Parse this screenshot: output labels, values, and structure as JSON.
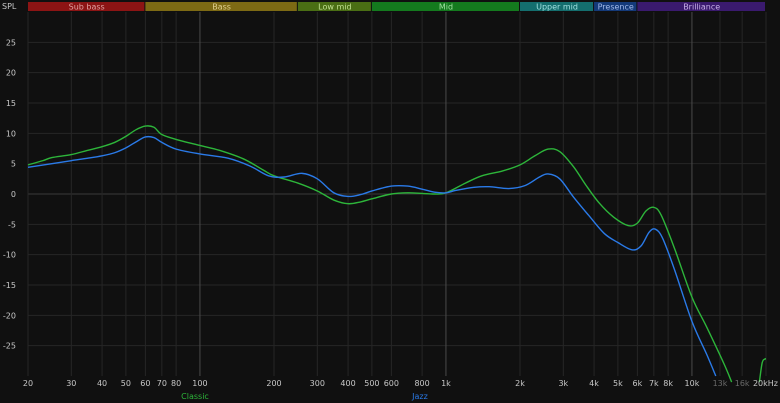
{
  "chart_data": {
    "type": "line",
    "ylabel": "SPL",
    "ylim": [
      -30,
      30
    ],
    "xlim": [
      20,
      20000
    ],
    "x_scale": "log",
    "grid": true,
    "x_ticks": [
      {
        "value": 20,
        "label": "20"
      },
      {
        "value": 30,
        "label": "30"
      },
      {
        "value": 40,
        "label": "40"
      },
      {
        "value": 50,
        "label": "50"
      },
      {
        "value": 60,
        "label": "60"
      },
      {
        "value": 70,
        "label": "70"
      },
      {
        "value": 80,
        "label": "80"
      },
      {
        "value": 100,
        "label": "100"
      },
      {
        "value": 200,
        "label": "200"
      },
      {
        "value": 300,
        "label": "300"
      },
      {
        "value": 400,
        "label": "400"
      },
      {
        "value": 500,
        "label": "500"
      },
      {
        "value": 600,
        "label": "600"
      },
      {
        "value": 800,
        "label": "800"
      },
      {
        "value": 1000,
        "label": "1k"
      },
      {
        "value": 2000,
        "label": "2k"
      },
      {
        "value": 3000,
        "label": "3k"
      },
      {
        "value": 4000,
        "label": "4k"
      },
      {
        "value": 5000,
        "label": "5k"
      },
      {
        "value": 6000,
        "label": "6k"
      },
      {
        "value": 7000,
        "label": "7k"
      },
      {
        "value": 8000,
        "label": "8k"
      },
      {
        "value": 10000,
        "label": "10k"
      },
      {
        "value": 13000,
        "label": "13k",
        "dim": true
      },
      {
        "value": 16000,
        "label": "16k",
        "dim": true
      },
      {
        "value": 20000,
        "label": "20kHz"
      }
    ],
    "y_ticks": [
      25,
      20,
      15,
      10,
      5,
      0,
      -5,
      -10,
      -15,
      -20,
      -25
    ],
    "bands": [
      {
        "label": "Sub bass",
        "from": 20,
        "to": 60,
        "color": "#8c1414",
        "text_color": "#e0a0a0"
      },
      {
        "label": "Bass",
        "from": 60,
        "to": 250,
        "color": "#7d6a14",
        "text_color": "#e0d090"
      },
      {
        "label": "Low mid",
        "from": 250,
        "to": 500,
        "color": "#4a6e14",
        "text_color": "#c0e090"
      },
      {
        "label": "Mid",
        "from": 500,
        "to": 2000,
        "color": "#147a1e",
        "text_color": "#a0e0a0"
      },
      {
        "label": "Upper mid",
        "from": 2000,
        "to": 4000,
        "color": "#146e6e",
        "text_color": "#a0e0e0"
      },
      {
        "label": "Presence",
        "from": 4000,
        "to": 6000,
        "color": "#143a7a",
        "text_color": "#a0b8e8"
      },
      {
        "label": "Brilliance",
        "from": 6000,
        "to": 20000,
        "color": "#3a1a6e",
        "text_color": "#c8b0e8"
      }
    ],
    "series": [
      {
        "name": "Classic",
        "color": "#2db53a",
        "points": [
          [
            20,
            4.8
          ],
          [
            23,
            5.5
          ],
          [
            25,
            6.0
          ],
          [
            30,
            6.5
          ],
          [
            35,
            7.2
          ],
          [
            40,
            7.8
          ],
          [
            45,
            8.5
          ],
          [
            50,
            9.5
          ],
          [
            55,
            10.6
          ],
          [
            60,
            11.2
          ],
          [
            65,
            11.0
          ],
          [
            70,
            9.8
          ],
          [
            80,
            9.0
          ],
          [
            100,
            8.0
          ],
          [
            120,
            7.2
          ],
          [
            150,
            5.8
          ],
          [
            180,
            4.0
          ],
          [
            200,
            3.0
          ],
          [
            250,
            1.8
          ],
          [
            300,
            0.5
          ],
          [
            350,
            -1.0
          ],
          [
            400,
            -1.6
          ],
          [
            450,
            -1.3
          ],
          [
            500,
            -0.8
          ],
          [
            600,
            0.0
          ],
          [
            700,
            0.2
          ],
          [
            800,
            0.1
          ],
          [
            900,
            0.0
          ],
          [
            1000,
            0.2
          ],
          [
            1200,
            1.8
          ],
          [
            1400,
            3.0
          ],
          [
            1700,
            3.8
          ],
          [
            2000,
            4.8
          ],
          [
            2300,
            6.3
          ],
          [
            2600,
            7.4
          ],
          [
            2900,
            7.0
          ],
          [
            3300,
            4.5
          ],
          [
            3700,
            1.5
          ],
          [
            4200,
            -1.5
          ],
          [
            4800,
            -3.8
          ],
          [
            5500,
            -5.2
          ],
          [
            6000,
            -4.8
          ],
          [
            6500,
            -2.8
          ],
          [
            7000,
            -2.2
          ],
          [
            7500,
            -3.5
          ],
          [
            8500,
            -9.0
          ],
          [
            10000,
            -17.0
          ],
          [
            11500,
            -22.0
          ],
          [
            13500,
            -28.0
          ],
          [
            14500,
            -31.0
          ]
        ]
      },
      {
        "name": "Jazz",
        "color": "#2a7ae8",
        "points": [
          [
            20,
            4.4
          ],
          [
            25,
            5.0
          ],
          [
            30,
            5.5
          ],
          [
            35,
            5.9
          ],
          [
            40,
            6.3
          ],
          [
            45,
            6.8
          ],
          [
            50,
            7.6
          ],
          [
            55,
            8.6
          ],
          [
            60,
            9.4
          ],
          [
            65,
            9.3
          ],
          [
            70,
            8.5
          ],
          [
            80,
            7.4
          ],
          [
            100,
            6.6
          ],
          [
            130,
            5.9
          ],
          [
            160,
            4.6
          ],
          [
            190,
            3.0
          ],
          [
            220,
            2.8
          ],
          [
            260,
            3.4
          ],
          [
            300,
            2.5
          ],
          [
            350,
            0.2
          ],
          [
            400,
            -0.4
          ],
          [
            450,
            -0.1
          ],
          [
            500,
            0.5
          ],
          [
            600,
            1.3
          ],
          [
            700,
            1.3
          ],
          [
            800,
            0.8
          ],
          [
            900,
            0.3
          ],
          [
            1000,
            0.2
          ],
          [
            1100,
            0.6
          ],
          [
            1300,
            1.1
          ],
          [
            1500,
            1.2
          ],
          [
            1800,
            0.9
          ],
          [
            2100,
            1.4
          ],
          [
            2400,
            2.8
          ],
          [
            2600,
            3.3
          ],
          [
            2900,
            2.5
          ],
          [
            3300,
            -0.5
          ],
          [
            3800,
            -3.5
          ],
          [
            4400,
            -6.5
          ],
          [
            5000,
            -8.0
          ],
          [
            5700,
            -9.2
          ],
          [
            6200,
            -8.6
          ],
          [
            6700,
            -6.3
          ],
          [
            7100,
            -5.8
          ],
          [
            7600,
            -7.3
          ],
          [
            8500,
            -12.5
          ],
          [
            10000,
            -21.0
          ],
          [
            11500,
            -26.5
          ],
          [
            12500,
            -30.0
          ]
        ]
      },
      {
        "name": "",
        "color": "#2db53a",
        "points": [
          [
            18800,
            -31.0
          ],
          [
            19300,
            -27.8
          ],
          [
            19800,
            -27.2
          ],
          [
            20000,
            -27.2
          ]
        ]
      }
    ]
  }
}
